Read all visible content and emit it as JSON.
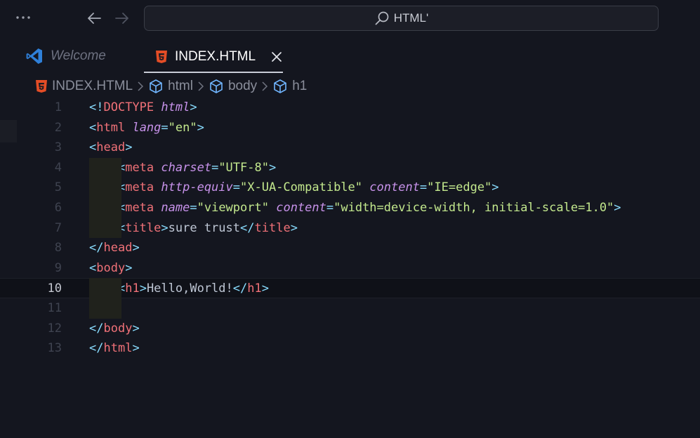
{
  "window": {
    "search_text": "HTML'"
  },
  "tabs": [
    {
      "label": "Welcome",
      "active": false
    },
    {
      "label": "INDEX.HTML",
      "active": true
    }
  ],
  "breadcrumb": [
    "INDEX.HTML",
    "html",
    "body",
    "h1"
  ],
  "colors": {
    "background": "#14161f",
    "html5_orange": "#e44d26",
    "vscode_blue": "#3b8eea",
    "tag": "#f07178",
    "punctuation": "#89ddff",
    "attribute": "#c792ea",
    "string": "#c3e88d",
    "text": "#bfc7d5"
  },
  "icons": {
    "more": "ellipsis-icon",
    "back": "arrow-left-icon",
    "forward": "arrow-right-icon",
    "search": "search-icon",
    "welcome": "vscode-logo-icon",
    "html_file": "html5-icon",
    "close": "close-icon",
    "element": "cube-icon",
    "separator": "chevron-right-icon"
  },
  "editor": {
    "current_line": 10,
    "lines": [
      {
        "n": "1",
        "code": "<!DOCTYPE html>"
      },
      {
        "n": "2",
        "code": "<html lang=\"en\">"
      },
      {
        "n": "3",
        "code": "<head>"
      },
      {
        "n": "4",
        "code": "    <meta charset=\"UTF-8\">"
      },
      {
        "n": "5",
        "code": "    <meta http-equiv=\"X-UA-Compatible\" content=\"IE=edge\">"
      },
      {
        "n": "6",
        "code": "    <meta name=\"viewport\" content=\"width=device-width, initial-scale=1.0\">"
      },
      {
        "n": "7",
        "code": "    <title>sure trust</title>"
      },
      {
        "n": "8",
        "code": "</head>"
      },
      {
        "n": "9",
        "code": "<body>"
      },
      {
        "n": "10",
        "code": "    <h1>Hello,World!</h1>"
      },
      {
        "n": "11",
        "code": ""
      },
      {
        "n": "12",
        "code": "</body>"
      },
      {
        "n": "13",
        "code": "</html>"
      }
    ]
  }
}
